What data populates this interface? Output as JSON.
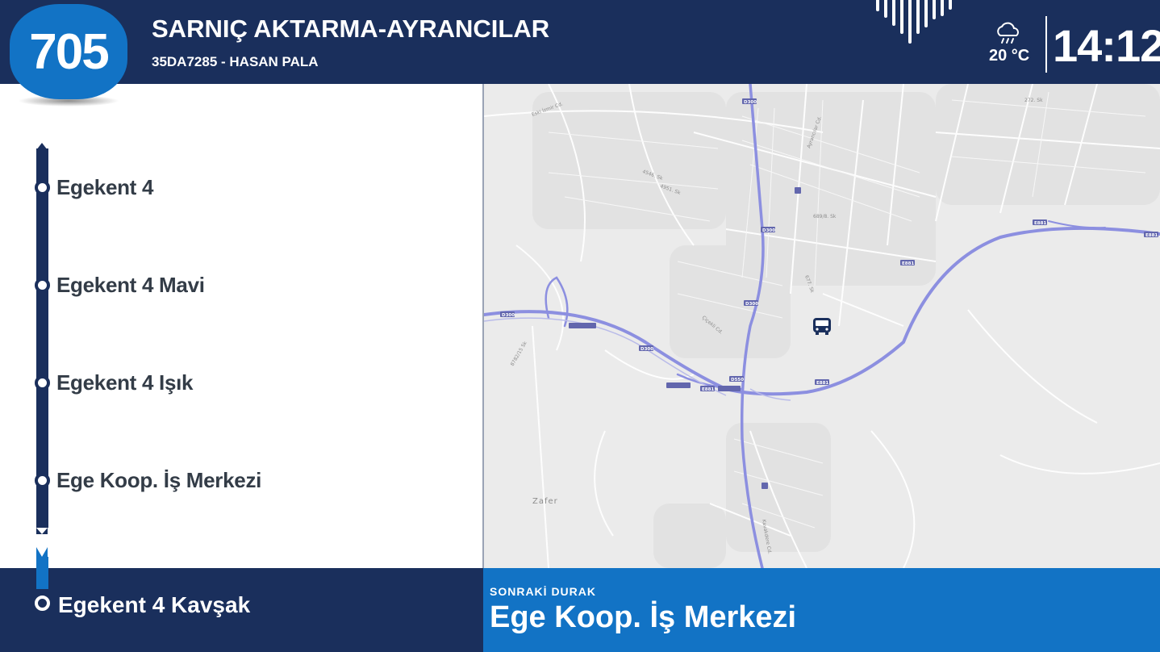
{
  "header": {
    "route_number": "705",
    "route_name": "SARNIÇ AKTARMA-AYRANCILAR",
    "vehicle_info": "35DA7285 - HASAN PALA",
    "temperature": "20 °C",
    "time": "14:12",
    "weather_icon": "rain-cloud-icon",
    "signal_icon": "signal-bars-icon"
  },
  "stops": [
    "Egekent 4",
    "Egekent 4 Mavi",
    "Egekent 4 Işık",
    "Ege Koop. İş Merkezi"
  ],
  "current_stop": "Egekent 4 Kavşak",
  "next_stop": {
    "caption": "SONRAKİ DURAK",
    "name": "Ege Koop. İş Merkezi"
  },
  "map": {
    "bus_icon": "bus-icon",
    "place_label": "Zafer",
    "road_shields": [
      "D300",
      "E881"
    ],
    "street_labels": [
      "Eski İzmir Cd.",
      "272. Sk",
      "4546. Sk",
      "4951. Sk",
      "689/8. Sk",
      "677. Sk",
      "Ayrancılar Cd.",
      "Kavakdere Cd.",
      "8782/15 Sk",
      "Çiçekli Cd."
    ]
  },
  "colors": {
    "header_bg": "#1a2f5c",
    "accent_blue": "#1273c5",
    "route_highlight": "#8c8fe0",
    "stop_text": "#333c47"
  }
}
